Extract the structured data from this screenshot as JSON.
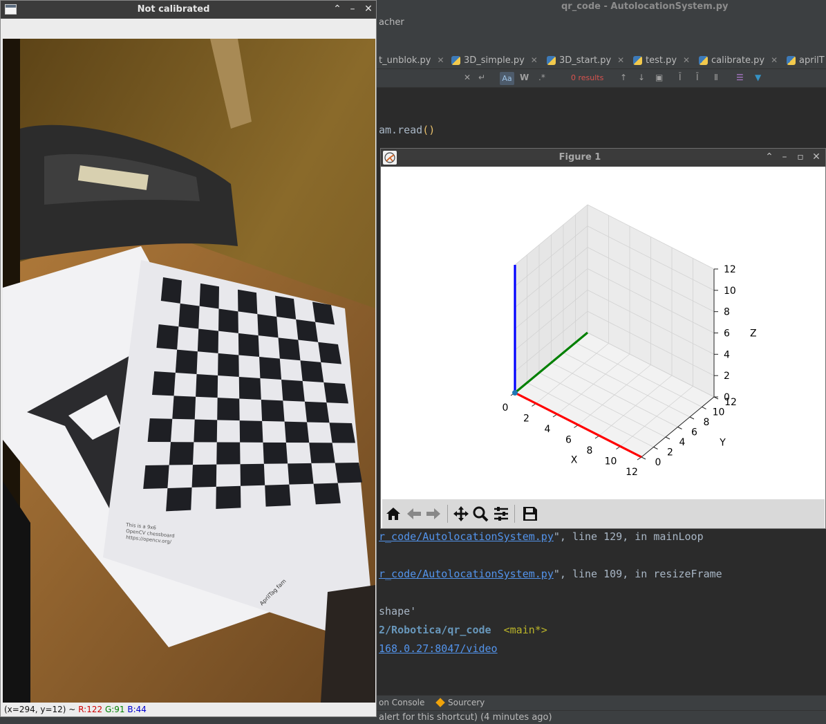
{
  "ide": {
    "title": "qr_code - AutolocationSystem.py",
    "menu_fragment": "acher",
    "tabs": [
      {
        "label": "t_unblok.py"
      },
      {
        "label": "3D_simple.py"
      },
      {
        "label": "3D_start.py"
      },
      {
        "label": "test.py"
      },
      {
        "label": "calibrate.py"
      },
      {
        "label": "aprilT"
      }
    ],
    "find": {
      "results": "0 results",
      "case_label": "Aa",
      "word_label": "W",
      "regex_label": ".*"
    },
    "code": {
      "line1": "am.read",
      "line1_parens": "()"
    },
    "console": {
      "file_link": "r_code/AutolocationSystem.py",
      "line1_suffix": "\", line 129, in mainLoop",
      "line2_suffix": "\", line 109, in resizeFrame",
      "shape_text": "shape'",
      "project_path": "2/Robotica/qr_code",
      "branch": "<main*>",
      "url": "168.0.27:8047/video"
    },
    "toolwindows": {
      "console_label": "on Console",
      "sourcery_label": "Sourcery"
    },
    "status": "alert for this shortcut) (4 minutes ago)"
  },
  "cv_window": {
    "title": "Not calibrated",
    "status": {
      "coords": "(x=294, y=12) ~",
      "r": "R:122",
      "g": "G:91",
      "b": "B:44"
    },
    "chessboard_caption": [
      "This is a 9x6",
      "OpenCV chessboard",
      "https://opencv.org/"
    ],
    "apriltag_caption": "AprilTag fam"
  },
  "figure_window": {
    "title": "Figure 1"
  },
  "chart_data": {
    "type": "line3d",
    "title": "",
    "xlabel": "X",
    "ylabel": "Y",
    "zlabel": "Z",
    "xlim": [
      0,
      12
    ],
    "ylim": [
      0,
      12
    ],
    "zlim": [
      0,
      12
    ],
    "x_ticks": [
      "0",
      "2",
      "4",
      "6",
      "8",
      "10",
      "12"
    ],
    "y_ticks": [
      "0",
      "2",
      "4",
      "6",
      "8",
      "10",
      "12"
    ],
    "z_ticks": [
      "0",
      "2",
      "4",
      "6",
      "8",
      "10",
      "12"
    ],
    "origin": [
      0,
      0,
      0
    ],
    "series": [
      {
        "color": "#ff0000",
        "from": [
          0,
          0,
          0
        ],
        "to": [
          12,
          0,
          0
        ]
      },
      {
        "color": "#008000",
        "from": [
          0,
          0,
          0
        ],
        "to": [
          0,
          12,
          0
        ]
      },
      {
        "color": "#0000ff",
        "from": [
          0,
          0,
          0
        ],
        "to": [
          0,
          0,
          12
        ]
      }
    ],
    "grid": true
  }
}
